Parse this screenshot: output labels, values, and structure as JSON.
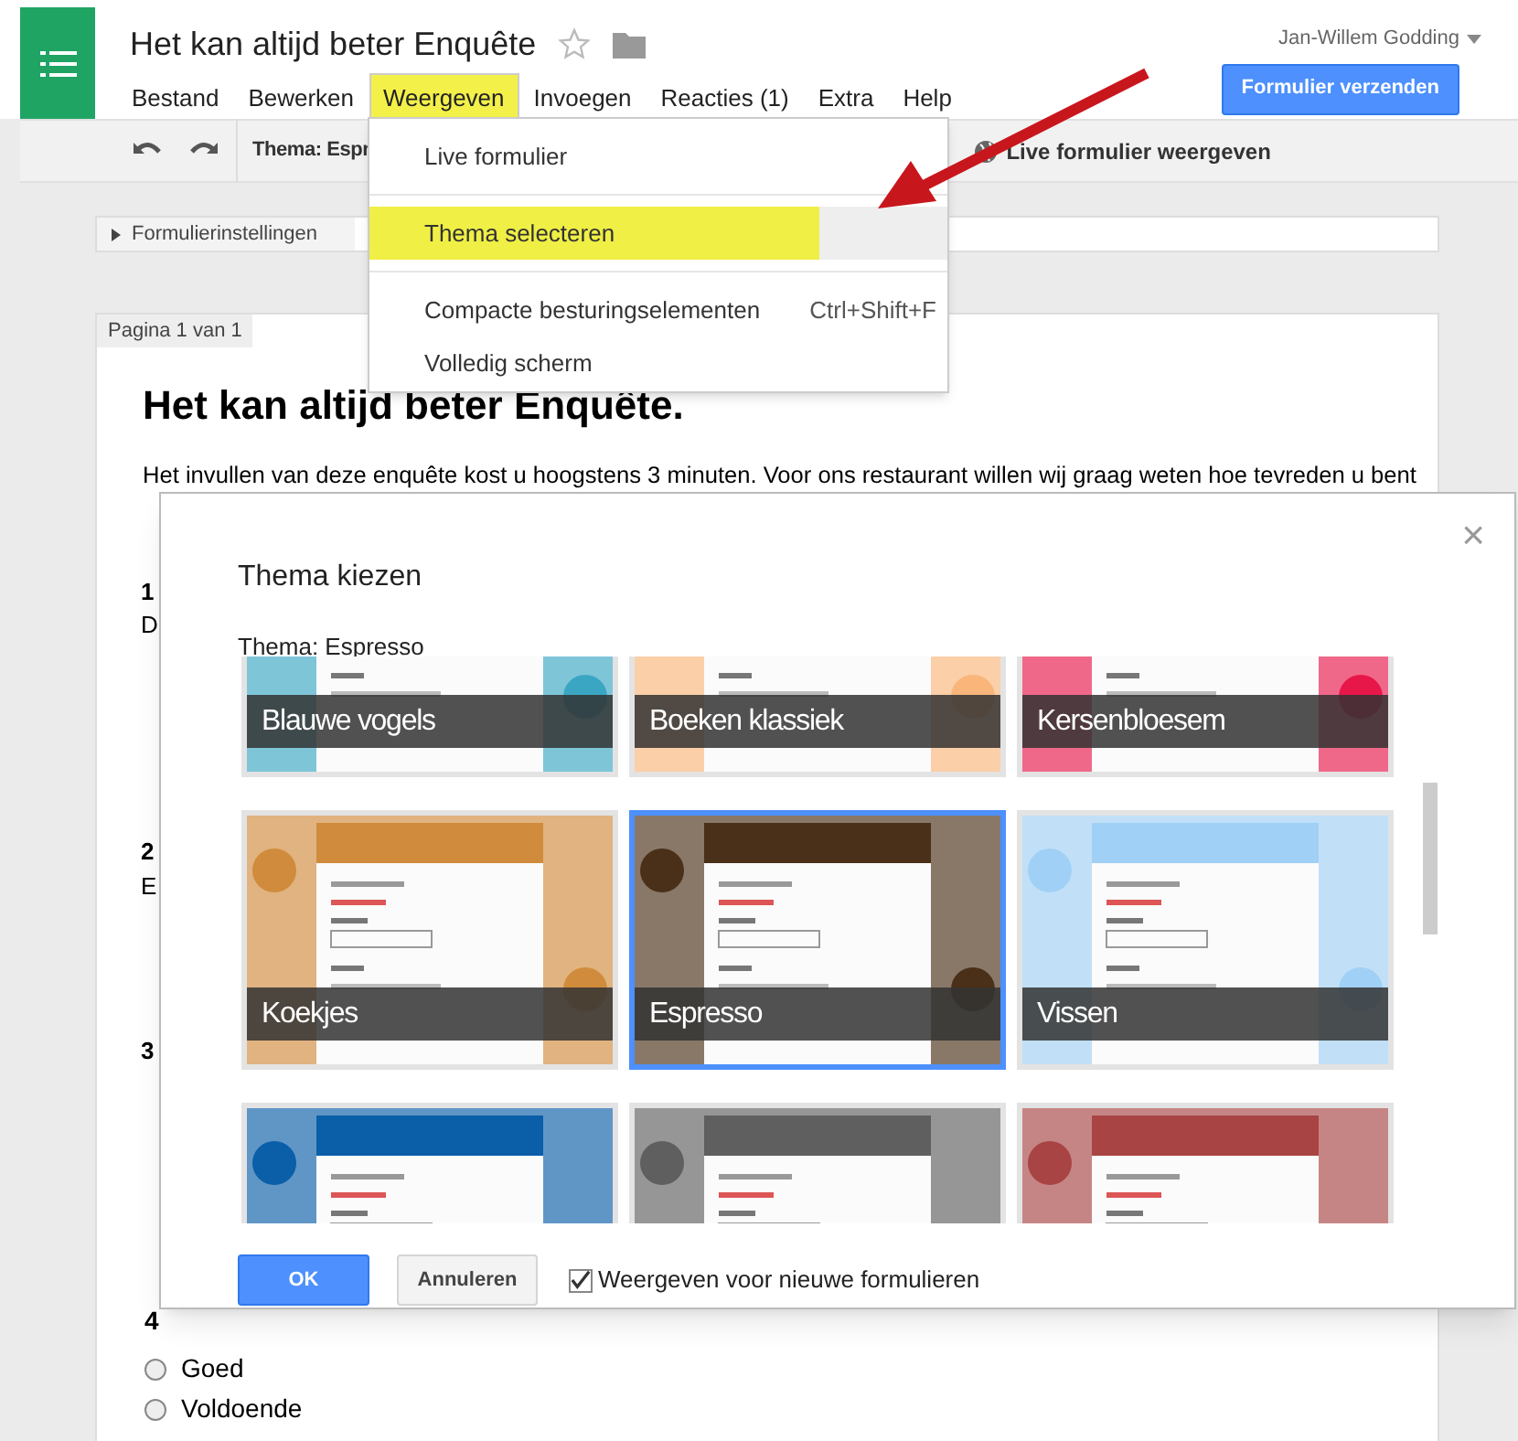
{
  "app": {
    "title": "Het kan altijd beter Enquête",
    "user": "Jan-Willem Godding",
    "send_button": "Formulier verzenden"
  },
  "menubar": [
    {
      "label": "Bestand",
      "selected": false
    },
    {
      "label": "Bewerken",
      "selected": false
    },
    {
      "label": "Weergeven",
      "selected": true
    },
    {
      "label": "Invoegen",
      "selected": false
    },
    {
      "label": "Reacties (1)",
      "selected": false
    },
    {
      "label": "Extra",
      "selected": false
    },
    {
      "label": "Help",
      "selected": false
    }
  ],
  "toolbar": {
    "theme_label": "Thema: Espr",
    "live_link": "Live formulier weergeven"
  },
  "settings_bar": {
    "label": "Formulierinstellingen",
    "expanded": false
  },
  "form": {
    "page_tab": "Pagina 1 van 1",
    "heading": "Het kan altijd beter Enquête.",
    "intro": "Het invullen van deze enquête kost u hoogstens 3 minuten. Voor ons restaurant willen wij graag weten hoe tevreden u bent",
    "fragments": [
      "1",
      "D",
      "2",
      "E",
      "3"
    ],
    "question_4_number": "4",
    "options": [
      {
        "label": "Goed",
        "selected": false
      },
      {
        "label": "Voldoende",
        "selected": false
      }
    ]
  },
  "view_menu": {
    "items": [
      {
        "kind": "item",
        "label": "Live formulier",
        "selected": false
      },
      {
        "kind": "separator"
      },
      {
        "kind": "item",
        "label": "Thema selecteren",
        "selected": true
      },
      {
        "kind": "separator"
      },
      {
        "kind": "item",
        "label": "Compacte besturingselementen",
        "shortcut": "Ctrl+Shift+F",
        "selected": false
      },
      {
        "kind": "item",
        "label": "Volledig scherm",
        "selected": false
      }
    ]
  },
  "dialog": {
    "title": "Thema kiezen",
    "close": "×",
    "current_theme": "Thema: Espresso",
    "themes": [
      {
        "label": "Blauwe vogels",
        "selected": false,
        "color": "#3aa6c4"
      },
      {
        "label": "Boeken klassiek",
        "selected": false,
        "color": "#f9b57a"
      },
      {
        "label": "Kersenbloesem",
        "selected": false,
        "color": "#e8174a"
      },
      {
        "label": "Koekjes",
        "selected": false,
        "color": "#d08b3c"
      },
      {
        "label": "Espresso",
        "selected": true,
        "color": "#4a3018"
      },
      {
        "label": "Vissen",
        "selected": false,
        "color": "#a0d0f5"
      },
      {
        "selected": false,
        "color": "#0b5ea8"
      },
      {
        "selected": false,
        "color": "#5f5f5f"
      },
      {
        "selected": false,
        "color": "#a84444"
      }
    ],
    "ok_button": "OK",
    "cancel_button": "Annuleren",
    "checkbox": {
      "label": "Weergeven voor nieuwe formulieren",
      "checked": true
    }
  }
}
